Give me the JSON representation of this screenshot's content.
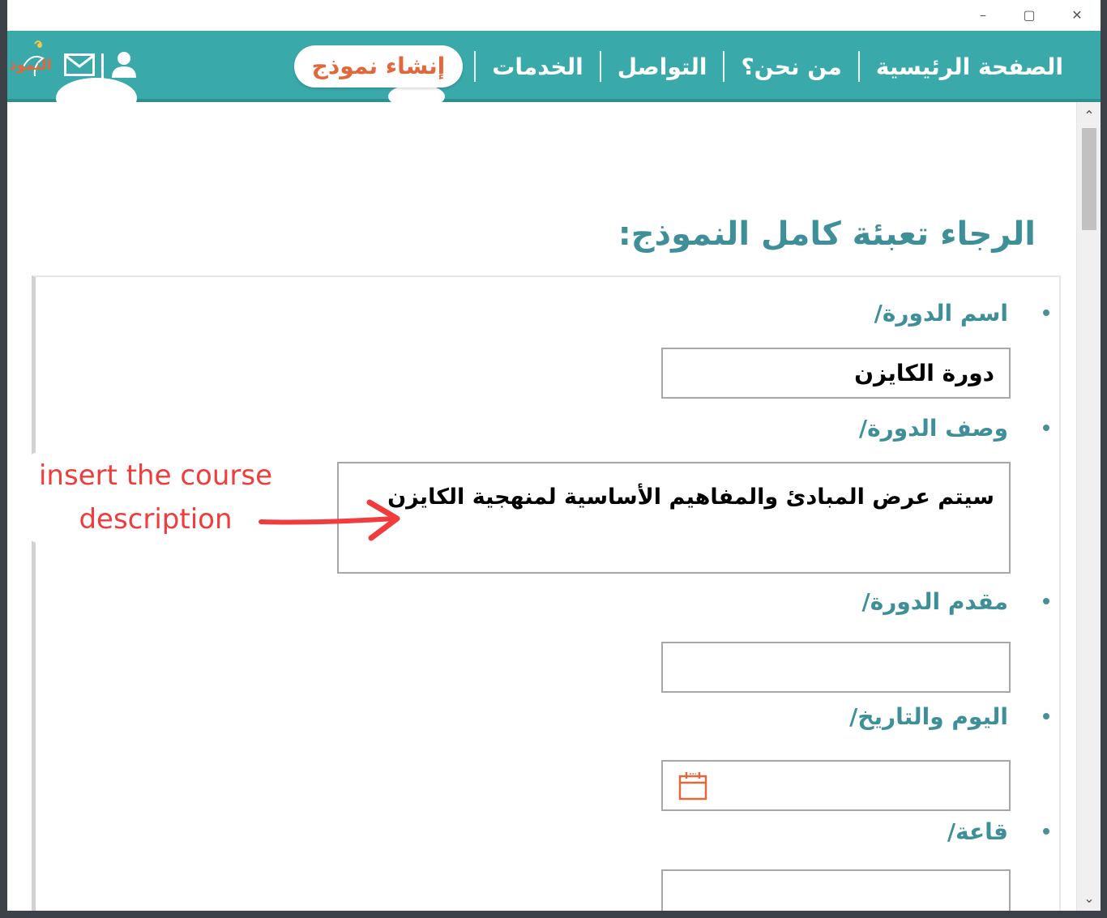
{
  "window": {
    "controls": {
      "minimize": "–",
      "maximize": "▢",
      "close": "✕"
    }
  },
  "header": {
    "logo_text": "النموذ",
    "icons": [
      "user-icon",
      "mail-icon",
      "logo-icon"
    ],
    "nav": {
      "home": "الصفحة الرئيسية",
      "about": "من نحن؟",
      "contact": "التواصل",
      "services": "الخدمات",
      "create_form": "إنشاء نموذج"
    },
    "colors": {
      "bar": "#3aa9aa",
      "accent": "#e0683a"
    }
  },
  "form": {
    "heading": "الرجاء تعبئة كامل النموذج:",
    "fields": {
      "course_name": {
        "label": "اسم الدورة/",
        "value": "دورة الكايزن"
      },
      "course_description": {
        "label": "وصف الدورة/",
        "value": "سيتم عرض المبادئ والمفاهيم الأساسية لمنهجية الكايزن"
      },
      "course_presenter": {
        "label": "مقدم الدورة/",
        "value": ""
      },
      "day_date": {
        "label": "اليوم والتاريخ/",
        "value": "",
        "icon": "calendar-icon"
      },
      "hall": {
        "label": "قاعة/",
        "value": ""
      }
    }
  },
  "annotation": {
    "line1": "insert the course",
    "line2": "description",
    "color": "#f03c3c"
  },
  "scrollbar": {
    "up": "⌃",
    "down": "⌄"
  }
}
